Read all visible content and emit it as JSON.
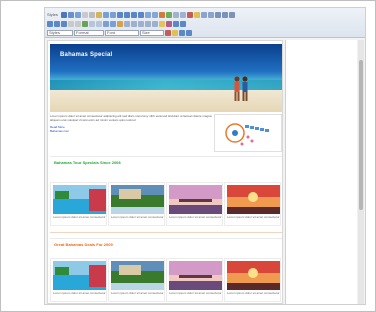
{
  "toolbar": {
    "row1_label": "Styles",
    "selects": [
      "Styles",
      "Format",
      "Font",
      "Size"
    ]
  },
  "banner": {
    "title": "Bahamas Special"
  },
  "intro": {
    "text": "Lorem ipsum dolor sit amet consectetur adipiscing elit sed diam nonummy nibh euismod tincidunt ut laoreet dolore magna aliquam erat volutpat Ut wisi enim ad minim veniam quis nostrud",
    "link1": "Read More",
    "link2": "Bahamas.com"
  },
  "sections": [
    {
      "title": "Bahamas Tour Specials Since 2008",
      "color": "#22aa33"
    },
    {
      "title": "Great Bahamas Deals For 2009",
      "color": "#ee6611"
    }
  ],
  "caption": "Lorem ipsum dolor sit amet consectetur",
  "colors": {
    "sea": "#1f6fc2",
    "sand": "#e6d7b5",
    "link": "#2244cc"
  }
}
